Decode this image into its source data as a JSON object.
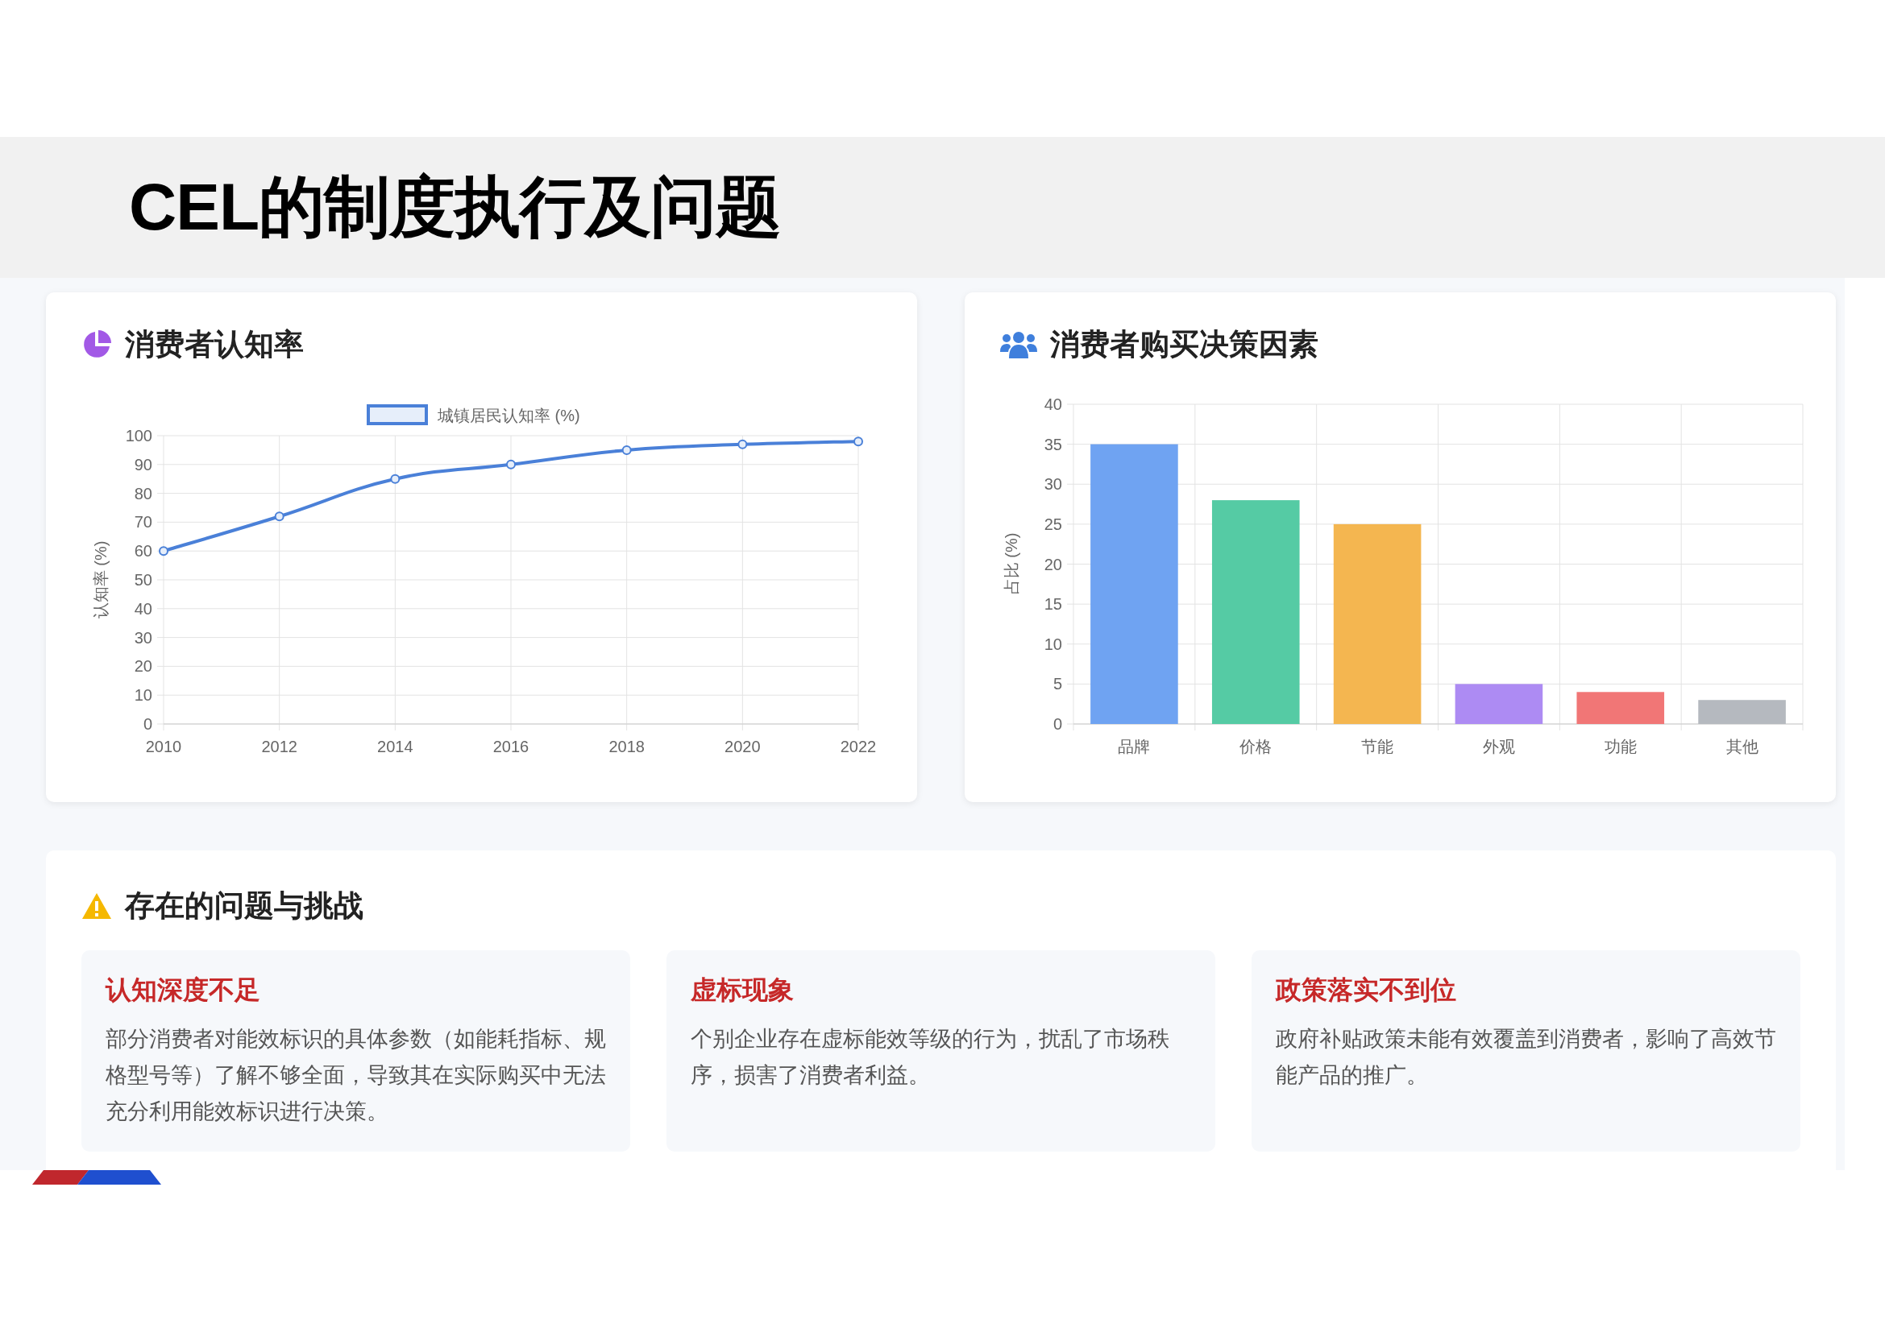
{
  "title": "CEL的制度执行及问题",
  "awareness_card": {
    "title": "消费者认知率",
    "chart_data": {
      "type": "line",
      "grid": true,
      "ylabel": "认知率 (%)",
      "x": [
        "2010",
        "2012",
        "2014",
        "2016",
        "2018",
        "2020",
        "2022"
      ],
      "ylim": [
        0,
        100
      ],
      "yticks": [
        0,
        10,
        20,
        30,
        40,
        50,
        60,
        70,
        80,
        90,
        100
      ],
      "series": [
        {
          "name": "城镇居民认知率 (%)",
          "color": "#4a80d8",
          "marker": true,
          "values": [
            60,
            72,
            85,
            90,
            95,
            97,
            98
          ]
        }
      ]
    }
  },
  "factors_card": {
    "title": "消费者购买决策因素",
    "chart_data": {
      "type": "bar",
      "grid": true,
      "ylabel": "占比 (%)",
      "categories": [
        "品牌",
        "价格",
        "节能",
        "外观",
        "功能",
        "其他"
      ],
      "ylim": [
        0,
        40
      ],
      "yticks": [
        0,
        5,
        10,
        15,
        20,
        25,
        30,
        35,
        40
      ],
      "values": [
        35,
        28,
        25,
        5,
        4,
        3
      ],
      "colors": [
        "#6fa3f2",
        "#55cba4",
        "#f4b650",
        "#ad8bf3",
        "#f17676",
        "#b5b9bf"
      ]
    }
  },
  "issues": {
    "title": "存在的问题与挑战",
    "items": [
      {
        "title": "认知深度不足",
        "text": "部分消费者对能效标识的具体参数（如能耗指标、规格型号等）了解不够全面，导致其在实际购买中无法充分利用能效标识进行决策。"
      },
      {
        "title": "虚标现象",
        "text": "个别企业存在虚标能效等级的行为，扰乱了市场秩序，损害了消费者利益。"
      },
      {
        "title": "政策落实不到位",
        "text": "政府补贴政策未能有效覆盖到消费者，影响了高效节能产品的推广。"
      }
    ]
  }
}
